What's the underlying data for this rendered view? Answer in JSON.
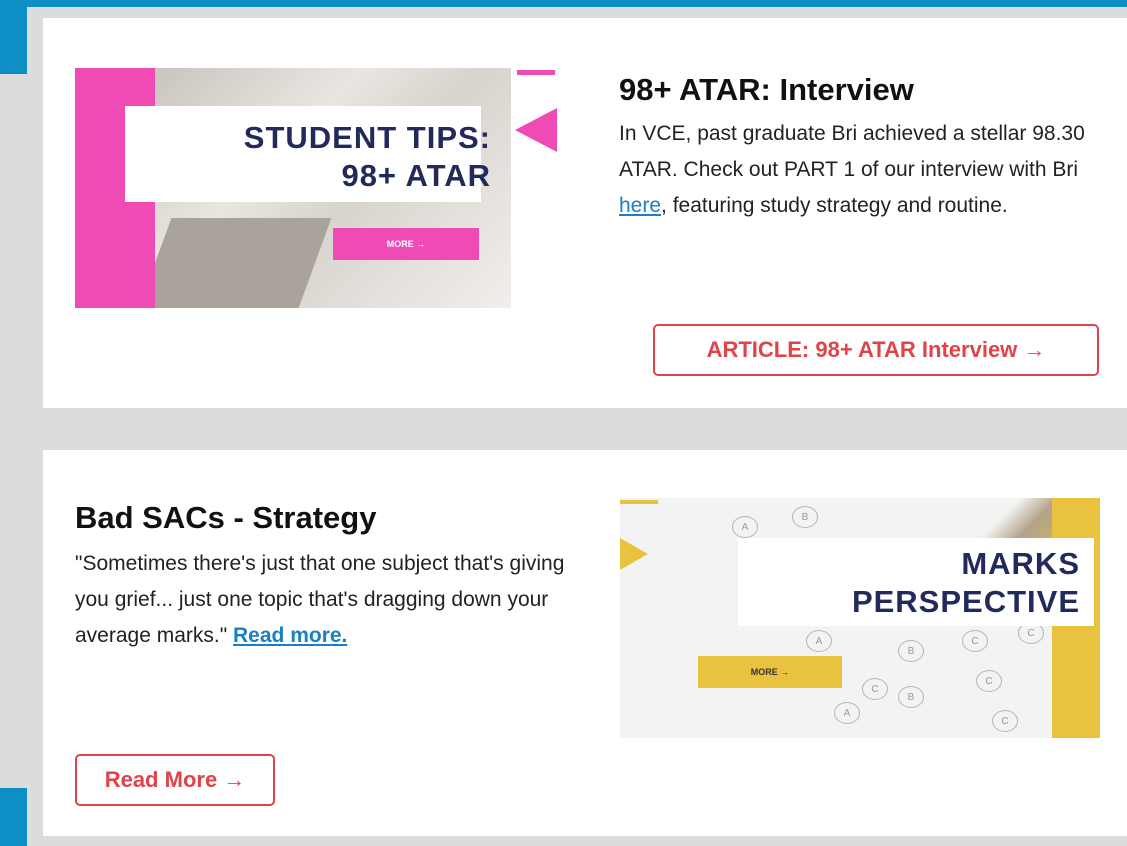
{
  "colors": {
    "frame_blue": "#0b8fc4",
    "cta_red": "#e0434a",
    "link_blue": "#1a7fc4",
    "pink_accent": "#f04ab4",
    "yellow_accent": "#e9c23f",
    "navy_text": "#222a5c"
  },
  "articles": [
    {
      "title": "98+ ATAR: Interview",
      "body_before_link": "In VCE, past graduate Bri achieved a stellar 98.30 ATAR. Check out PART 1 of our interview with Bri ",
      "link_text": "here",
      "body_after_link": ", featuring study strategy and routine.",
      "cta_label": "ARTICLE: 98+ ATAR Interview →",
      "image": {
        "line1": "STUDENT TIPS:",
        "line2": "98+ ATAR",
        "more_label": "MORE →",
        "icon": "student-tips-banner"
      }
    },
    {
      "title": "Bad SACs - Strategy",
      "body_before_link": "\"Sometimes there's just that one subject that's giving you grief... just one topic that's dragging down your average marks.\" ",
      "link_text": "Read more.",
      "body_after_link": "",
      "cta_label": "Read More →",
      "image": {
        "line1": "MARKS",
        "line2": "PERSPECTIVE",
        "more_label": "MORE →",
        "icon": "marks-perspective-banner"
      }
    }
  ]
}
